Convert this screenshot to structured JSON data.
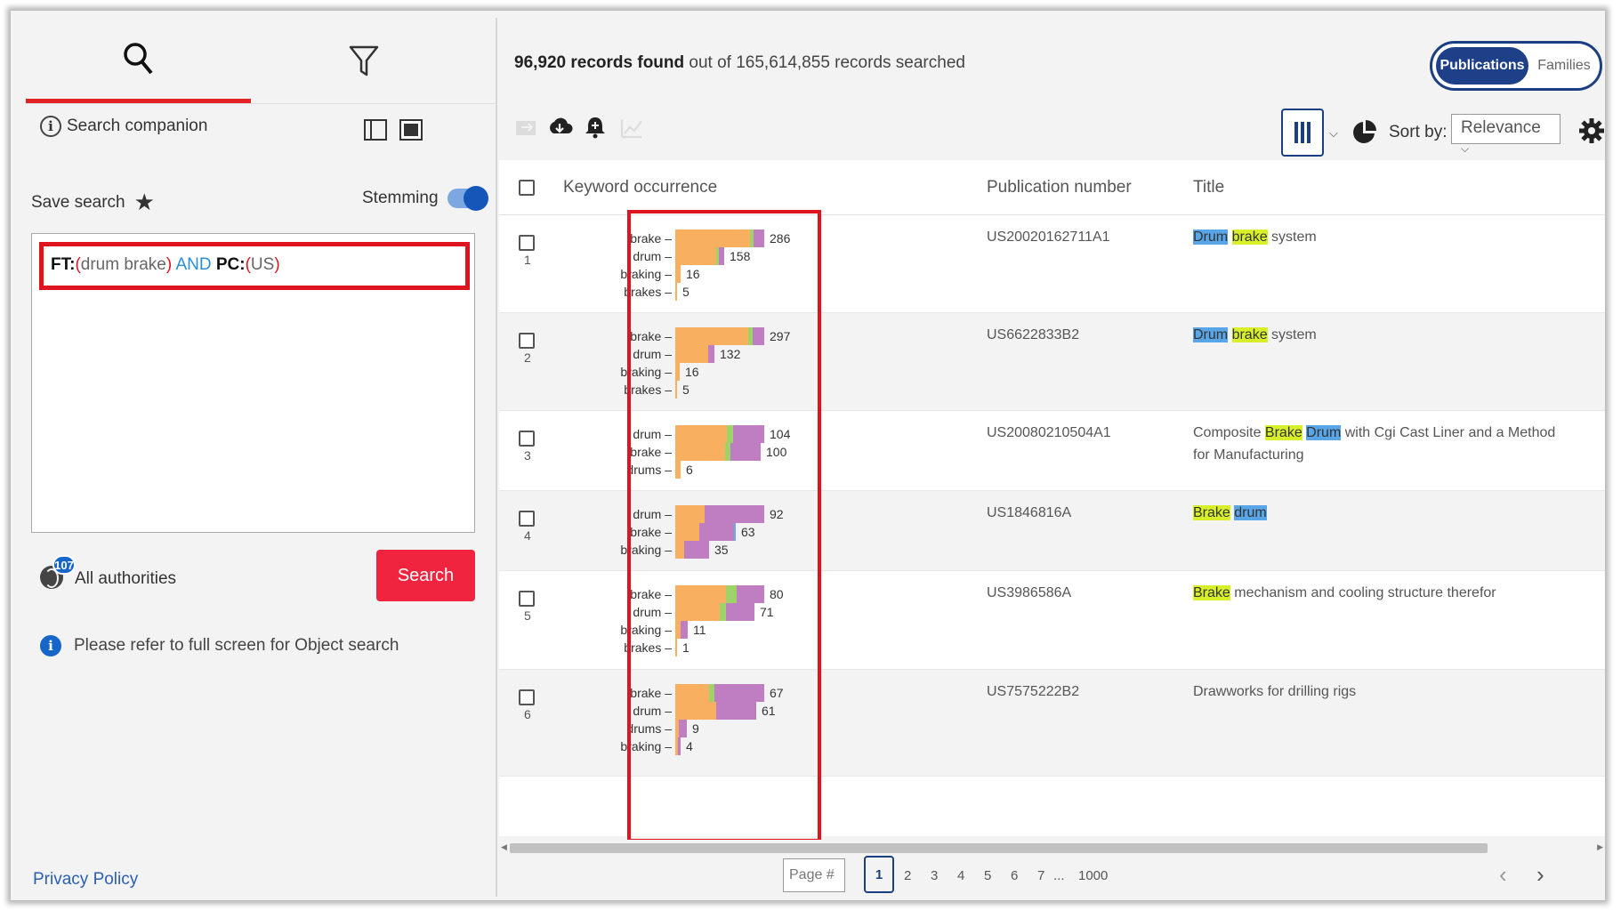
{
  "left_panel": {
    "tabs": [
      {
        "name": "search",
        "icon": "search-icon"
      },
      {
        "name": "filter",
        "icon": "filter-icon"
      }
    ],
    "companion_label": "Search companion",
    "save_label": "Save search",
    "stemming_label": "Stemming",
    "stemming_on": true,
    "query": {
      "key1": "FT:",
      "open1": "(",
      "terms1": "drum brake",
      "close1": ")",
      "op": "AND",
      "key2": "PC:",
      "open2": "(",
      "terms2": "US",
      "close2": ")"
    },
    "authorities_count": "107",
    "authorities_label": "All authorities",
    "search_button": "Search",
    "note": "Please refer to full screen for Object search",
    "privacy": "Privacy Policy"
  },
  "header": {
    "records_found": "96,920 records found",
    "records_rest": "out of 165,614,855 records searched",
    "toggle_publications": "Publications",
    "toggle_families": "Families",
    "sort_label": "Sort by:",
    "sort_value": "Relevance"
  },
  "columns": {
    "keyword": "Keyword occurrence",
    "pubno": "Publication number",
    "title": "Title"
  },
  "colors": {
    "orange": "#f8b060",
    "green": "#9ed36a",
    "purple": "#c07ec2",
    "blue": "#6aa8e8",
    "highlight_yellow": "#d8f02a",
    "highlight_blue": "#58a6e8",
    "accent_red": "#e0141f",
    "navy": "#1b3f80"
  },
  "rows": [
    {
      "num": "1",
      "pubno": "US20020162711A1",
      "title": [
        {
          "t": "Drum",
          "h": "b"
        },
        {
          "t": " "
        },
        {
          "t": "brake",
          "h": "y"
        },
        {
          "t": " system"
        }
      ],
      "kw": [
        {
          "label": "brake",
          "value": 286,
          "segs": [
            [
              "orange",
              0.84
            ],
            [
              "green",
              0.04
            ],
            [
              "purple",
              0.12
            ]
          ]
        },
        {
          "label": "drum",
          "value": 158,
          "segs": [
            [
              "orange",
              0.84
            ],
            [
              "green",
              0.06
            ],
            [
              "purple",
              0.1
            ]
          ]
        },
        {
          "label": "braking",
          "value": 16,
          "segs": [
            [
              "orange",
              1.0
            ]
          ]
        },
        {
          "label": "brakes",
          "value": 5,
          "segs": [
            [
              "orange",
              1.0
            ]
          ]
        }
      ]
    },
    {
      "num": "2",
      "pubno": "US6622833B2",
      "title": [
        {
          "t": "Drum",
          "h": "b"
        },
        {
          "t": " "
        },
        {
          "t": "brake",
          "h": "y"
        },
        {
          "t": " system"
        }
      ],
      "kw": [
        {
          "label": "brake",
          "value": 297,
          "segs": [
            [
              "orange",
              0.82
            ],
            [
              "green",
              0.05
            ],
            [
              "purple",
              0.13
            ]
          ]
        },
        {
          "label": "drum",
          "value": 132,
          "segs": [
            [
              "orange",
              0.85
            ],
            [
              "purple",
              0.15
            ]
          ]
        },
        {
          "label": "braking",
          "value": 16,
          "segs": [
            [
              "orange",
              1.0
            ]
          ]
        },
        {
          "label": "brakes",
          "value": 5,
          "segs": [
            [
              "orange",
              1.0
            ]
          ]
        }
      ]
    },
    {
      "num": "3",
      "pubno": "US20080210504A1",
      "title": [
        {
          "t": "Composite "
        },
        {
          "t": "Brake",
          "h": "y"
        },
        {
          "t": " "
        },
        {
          "t": "Drum",
          "h": "b"
        },
        {
          "t": " with Cgi Cast Liner and a Method for Manufacturing"
        }
      ],
      "kw": [
        {
          "label": "drum",
          "value": 104,
          "segs": [
            [
              "orange",
              0.58
            ],
            [
              "green",
              0.07
            ],
            [
              "purple",
              0.35
            ]
          ]
        },
        {
          "label": "brake",
          "value": 100,
          "segs": [
            [
              "orange",
              0.58
            ],
            [
              "green",
              0.07
            ],
            [
              "purple",
              0.35
            ]
          ]
        },
        {
          "label": "drums",
          "value": 6,
          "segs": [
            [
              "orange",
              1.0
            ]
          ]
        }
      ]
    },
    {
      "num": "4",
      "pubno": "US1846816A",
      "title": [
        {
          "t": "Brake",
          "h": "y"
        },
        {
          "t": " "
        },
        {
          "t": "drum",
          "h": "b"
        }
      ],
      "kw": [
        {
          "label": "drum",
          "value": 92,
          "segs": [
            [
              "orange",
              0.33
            ],
            [
              "purple",
              0.67
            ]
          ]
        },
        {
          "label": "brake",
          "value": 63,
          "segs": [
            [
              "orange",
              0.4
            ],
            [
              "purple",
              0.57
            ],
            [
              "blue",
              0.03
            ]
          ]
        },
        {
          "label": "braking",
          "value": 35,
          "segs": [
            [
              "orange",
              0.25
            ],
            [
              "purple",
              0.75
            ]
          ]
        }
      ]
    },
    {
      "num": "5",
      "pubno": "US3986586A",
      "title": [
        {
          "t": "Brake",
          "h": "y"
        },
        {
          "t": " mechanism and cooling structure therefor"
        }
      ],
      "kw": [
        {
          "label": "brake",
          "value": 80,
          "segs": [
            [
              "orange",
              0.57
            ],
            [
              "green",
              0.12
            ],
            [
              "purple",
              0.31
            ]
          ]
        },
        {
          "label": "drum",
          "value": 71,
          "segs": [
            [
              "orange",
              0.56
            ],
            [
              "green",
              0.08
            ],
            [
              "purple",
              0.36
            ]
          ]
        },
        {
          "label": "braking",
          "value": 11,
          "segs": [
            [
              "orange",
              0.4
            ],
            [
              "purple",
              0.6
            ]
          ]
        },
        {
          "label": "brakes",
          "value": 1,
          "segs": [
            [
              "orange",
              1.0
            ]
          ]
        }
      ]
    },
    {
      "num": "6",
      "pubno": "US7575222B2",
      "title": [
        {
          "t": "Drawworks for drilling rigs"
        }
      ],
      "kw": [
        {
          "label": "brake",
          "value": 67,
          "segs": [
            [
              "orange",
              0.38
            ],
            [
              "green",
              0.06
            ],
            [
              "purple",
              0.56
            ]
          ]
        },
        {
          "label": "drum",
          "value": 61,
          "segs": [
            [
              "orange",
              0.5
            ],
            [
              "purple",
              0.5
            ]
          ]
        },
        {
          "label": "drums",
          "value": 9,
          "segs": [
            [
              "orange",
              0.3
            ],
            [
              "purple",
              0.7
            ]
          ]
        },
        {
          "label": "braking",
          "value": 4,
          "segs": [
            [
              "orange",
              0.5
            ],
            [
              "purple",
              0.5
            ]
          ]
        }
      ]
    }
  ],
  "pager": {
    "placeholder": "Page #",
    "pages": [
      "1",
      "2",
      "3",
      "4",
      "5",
      "6",
      "7"
    ],
    "ellipsis": "...",
    "last": "1000",
    "current": "1"
  }
}
